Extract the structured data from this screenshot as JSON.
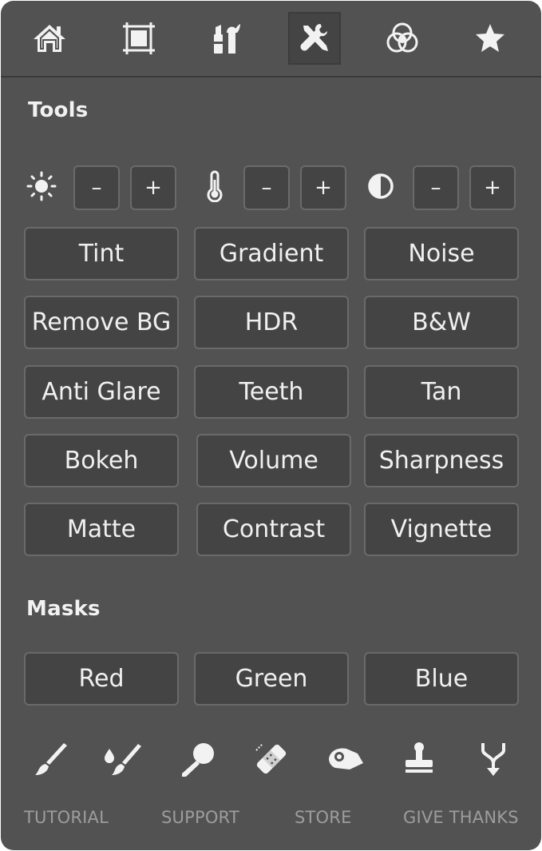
{
  "colors": {
    "panel": "#525252",
    "button": "#444444",
    "button_border": "#6a6a6a",
    "text": "#f0f0f0",
    "muted": "#9d9d9d",
    "icon": "#f2f2f2"
  },
  "top_tabs": [
    {
      "icon": "home-icon"
    },
    {
      "icon": "crop-frame-icon"
    },
    {
      "icon": "makeup-icon"
    },
    {
      "icon": "tools-icon",
      "active": true
    },
    {
      "icon": "color-circles-icon"
    },
    {
      "icon": "star-icon"
    }
  ],
  "tools": {
    "title": "Tools",
    "adjusters": [
      {
        "icon": "brightness-icon",
        "minus": "–",
        "plus": "+"
      },
      {
        "icon": "temperature-icon",
        "minus": "–",
        "plus": "+"
      },
      {
        "icon": "contrast-icon",
        "minus": "–",
        "plus": "+"
      }
    ],
    "buttons": [
      "Tint",
      "Gradient",
      "Noise",
      "Remove BG",
      "HDR",
      "B&W",
      "Anti Glare",
      "Teeth",
      "Tan",
      "Bokeh",
      "Volume",
      "Sharpness",
      "Matte",
      "Contrast",
      "Vignette"
    ]
  },
  "masks": {
    "title": "Masks",
    "buttons": [
      "Red",
      "Green",
      "Blue"
    ]
  },
  "bottom_icons": [
    "brush-icon",
    "paint-brush-drop-icon",
    "magnifier-icon",
    "bandage-icon",
    "eraser-hand-icon",
    "stamp-icon",
    "merge-icon"
  ],
  "footer_links": [
    "TUTORIAL",
    "SUPPORT",
    "STORE",
    "GIVE THANKS"
  ]
}
